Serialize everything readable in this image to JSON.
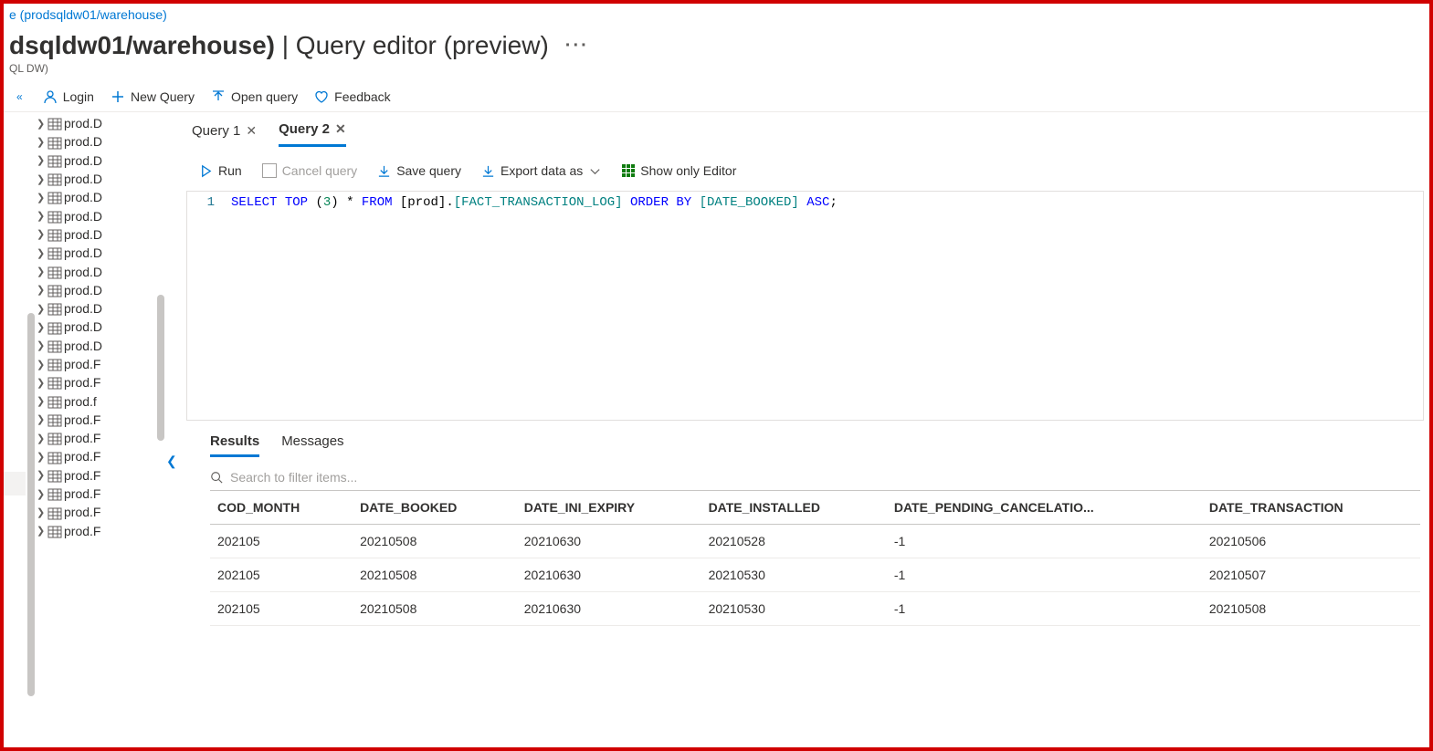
{
  "breadcrumb": {
    "link": "e (prodsqldw01/warehouse)"
  },
  "header": {
    "title_prefix": "dsqldw01/warehouse)",
    "title_suffix": "| Query editor (preview)",
    "subtitle": "QL DW)",
    "more": "···"
  },
  "toolbar": {
    "collapse": "«",
    "login": "Login",
    "new_query": "New Query",
    "open_query": "Open query",
    "feedback": "Feedback"
  },
  "sidebar": {
    "items": [
      {
        "label": "prod.D"
      },
      {
        "label": "prod.D"
      },
      {
        "label": "prod.D"
      },
      {
        "label": "prod.D"
      },
      {
        "label": "prod.D"
      },
      {
        "label": "prod.D"
      },
      {
        "label": "prod.D"
      },
      {
        "label": "prod.D"
      },
      {
        "label": "prod.D"
      },
      {
        "label": "prod.D"
      },
      {
        "label": "prod.D"
      },
      {
        "label": "prod.D"
      },
      {
        "label": "prod.D"
      },
      {
        "label": "prod.F"
      },
      {
        "label": "prod.F"
      },
      {
        "label": "prod.f"
      },
      {
        "label": "prod.F"
      },
      {
        "label": "prod.F"
      },
      {
        "label": "prod.F"
      },
      {
        "label": "prod.F"
      },
      {
        "label": "prod.F"
      },
      {
        "label": "prod.F"
      },
      {
        "label": "prod.F"
      }
    ]
  },
  "tabs": {
    "items": [
      {
        "label": "Query 1",
        "active": false
      },
      {
        "label": "Query 2",
        "active": true
      }
    ]
  },
  "query_toolbar": {
    "run": "Run",
    "cancel": "Cancel query",
    "save": "Save query",
    "export": "Export data as",
    "show_editor": "Show only Editor"
  },
  "editor": {
    "line_number": "1",
    "tokens": {
      "select": "SELECT",
      "top": "TOP",
      "paren_open": "(",
      "num": "3",
      "paren_close": ")",
      "star": "*",
      "from": "FROM",
      "schema": "[prod].",
      "table": "[FACT_TRANSACTION_LOG]",
      "order_by": "ORDER BY",
      "col": "[DATE_BOOKED]",
      "asc": "ASC",
      "semi": ";"
    }
  },
  "results": {
    "tabs": {
      "results": "Results",
      "messages": "Messages"
    },
    "search_placeholder": "Search to filter items...",
    "columns": [
      "COD_MONTH",
      "DATE_BOOKED",
      "DATE_INI_EXPIRY",
      "DATE_INSTALLED",
      "DATE_PENDING_CANCELATIO...",
      "DATE_TRANSACTION"
    ],
    "rows": [
      [
        "202105",
        "20210508",
        "20210630",
        "20210528",
        "-1",
        "20210506"
      ],
      [
        "202105",
        "20210508",
        "20210630",
        "20210530",
        "-1",
        "20210507"
      ],
      [
        "202105",
        "20210508",
        "20210630",
        "20210530",
        "-1",
        "20210508"
      ]
    ]
  }
}
